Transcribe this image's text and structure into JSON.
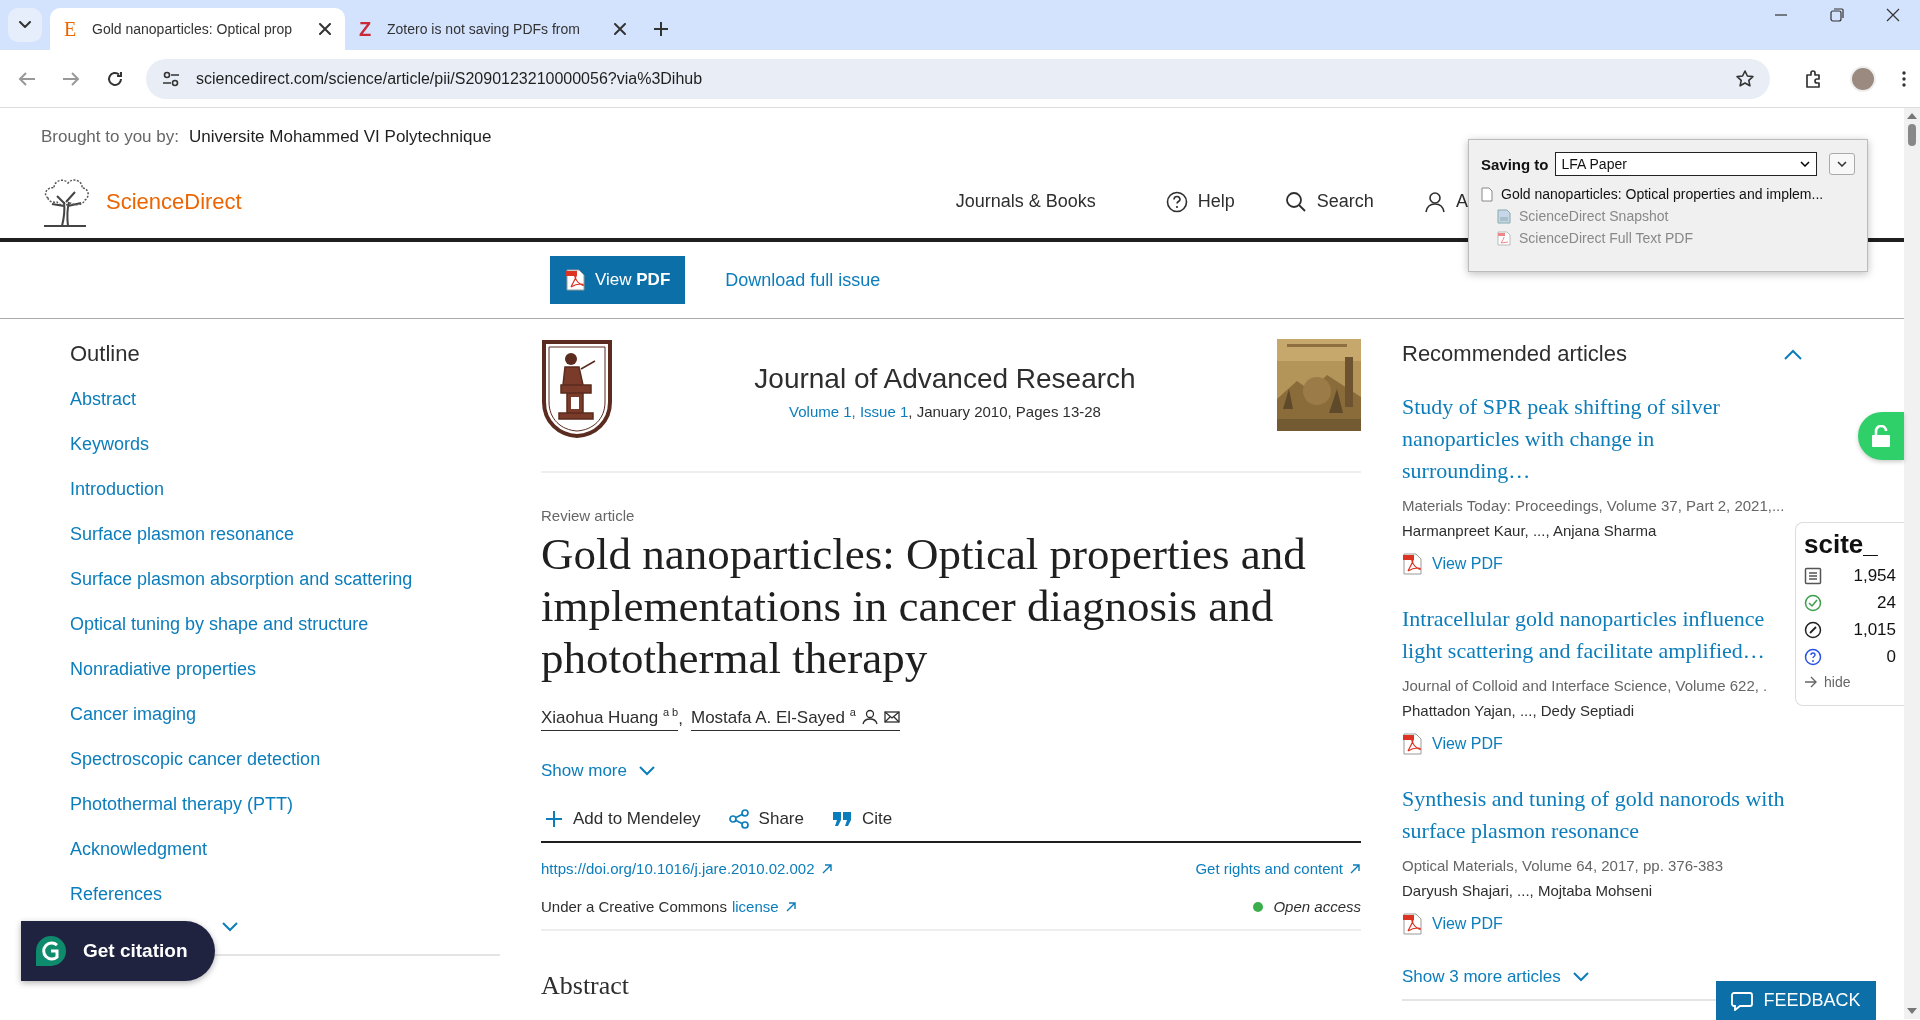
{
  "browser": {
    "tabs": [
      {
        "title": "Gold nanoparticles: Optical prop",
        "favicon": "E",
        "selected": true
      },
      {
        "title": "Zotero is not saving PDFs from",
        "favicon": "Z",
        "selected": false
      }
    ],
    "url": "sciencedirect.com/science/article/pii/S2090123210000056?via%3Dihub"
  },
  "brought": {
    "label": "Brought to you by:",
    "institution": "Universite Mohammed VI Polytechnique"
  },
  "header": {
    "brand": "ScienceDirect",
    "nav": [
      {
        "label": "Journals & Books",
        "kind": "plain"
      },
      {
        "label": "Help",
        "kind": "help"
      },
      {
        "label": "Search",
        "kind": "search"
      },
      {
        "label": "A",
        "kind": "account"
      }
    ]
  },
  "toolbar": {
    "view_pdf": "View **PDF**",
    "download": "Download full issue"
  },
  "outline": {
    "title": "Outline",
    "items": [
      "Abstract",
      "Keywords",
      "Introduction",
      "Surface plasmon resonance",
      "Surface plasmon absorption and scattering",
      "Optical tuning by shape and structure",
      "Nonradiative properties",
      "Cancer imaging",
      "Spectroscopic cancer detection",
      "Photothermal therapy (PTT)",
      "Acknowledgment",
      "References"
    ]
  },
  "article": {
    "journal": "Journal of Advanced Research",
    "issue_link": "Volume 1, Issue 1",
    "issue_rest": ", January 2010, Pages 13-28",
    "type": "Review article",
    "title": "Gold nanoparticles: Optical properties and implementations in cancer diagnosis and photothermal therapy",
    "authors": [
      {
        "name": "Xiaohua Huang $^{a b}$",
        "corresponding": false
      },
      {
        "name": "Mostafa A. El-Sayed $^{a}$",
        "separator": ",",
        "corresponding": true
      }
    ],
    "show_more": "Show more",
    "actions": [
      {
        "label": "Add to Mendeley",
        "kind": "add"
      },
      {
        "label": "Share",
        "kind": "share"
      },
      {
        "label": "Cite",
        "kind": "cite"
      }
    ],
    "doi": "https://doi.org/10.1016/j.jare.2010.02.002",
    "rights": "Get rights and content",
    "license_prefix": "Under a Creative Commons",
    "license_link": "license",
    "access": "Open access",
    "abstract": "Abstract"
  },
  "recommended": {
    "title": "Recommended articles",
    "expanded": true,
    "articles": [
      {
        "title": "Study of SPR peak shifting of silver nanoparticles with change in surrounding…",
        "source": "Materials Today: Proceedings, Volume 37, Part 2, 2021,...",
        "authors": "Harmanpreet Kaur, ..., Anjana Sharma",
        "pdf": "View PDF"
      },
      {
        "title": "Intracellular gold nanoparticles influence light scattering and facilitate amplified…",
        "source": "Journal of Colloid and Interface Science, Volume 622, .",
        "authors": "Phattadon Yajan, ..., Dedy Septiadi",
        "pdf": "View PDF"
      },
      {
        "title": "Synthesis and tuning of gold nanorods with surface plasmon resonance",
        "source": "Optical Materials, Volume 64, 2017, pp. 376-383",
        "authors": "Daryush Shajari, ..., Mojtaba Mohseni",
        "pdf": "View PDF"
      }
    ],
    "show_more": "Show 3 more articles"
  },
  "zotero": {
    "label": "Saving to",
    "collection": "LFA Paper",
    "item": "Gold nanoparticles: Optical properties and implem...",
    "attachments": [
      {
        "label": "ScienceDirect Snapshot",
        "kind": "snapshot"
      },
      {
        "label": "ScienceDirect Full Text PDF",
        "kind": "pdf"
      }
    ]
  },
  "scite": {
    "brand": "scite_",
    "metrics": [
      {
        "kind": "citing",
        "value": "1,954"
      },
      {
        "kind": "supporting",
        "value": "24"
      },
      {
        "kind": "contrasting",
        "value": "1,015"
      },
      {
        "kind": "mentioning",
        "value": "0"
      }
    ],
    "hide": "hide"
  },
  "get_citation": "Get citation",
  "feedback": "FEEDBACK"
}
